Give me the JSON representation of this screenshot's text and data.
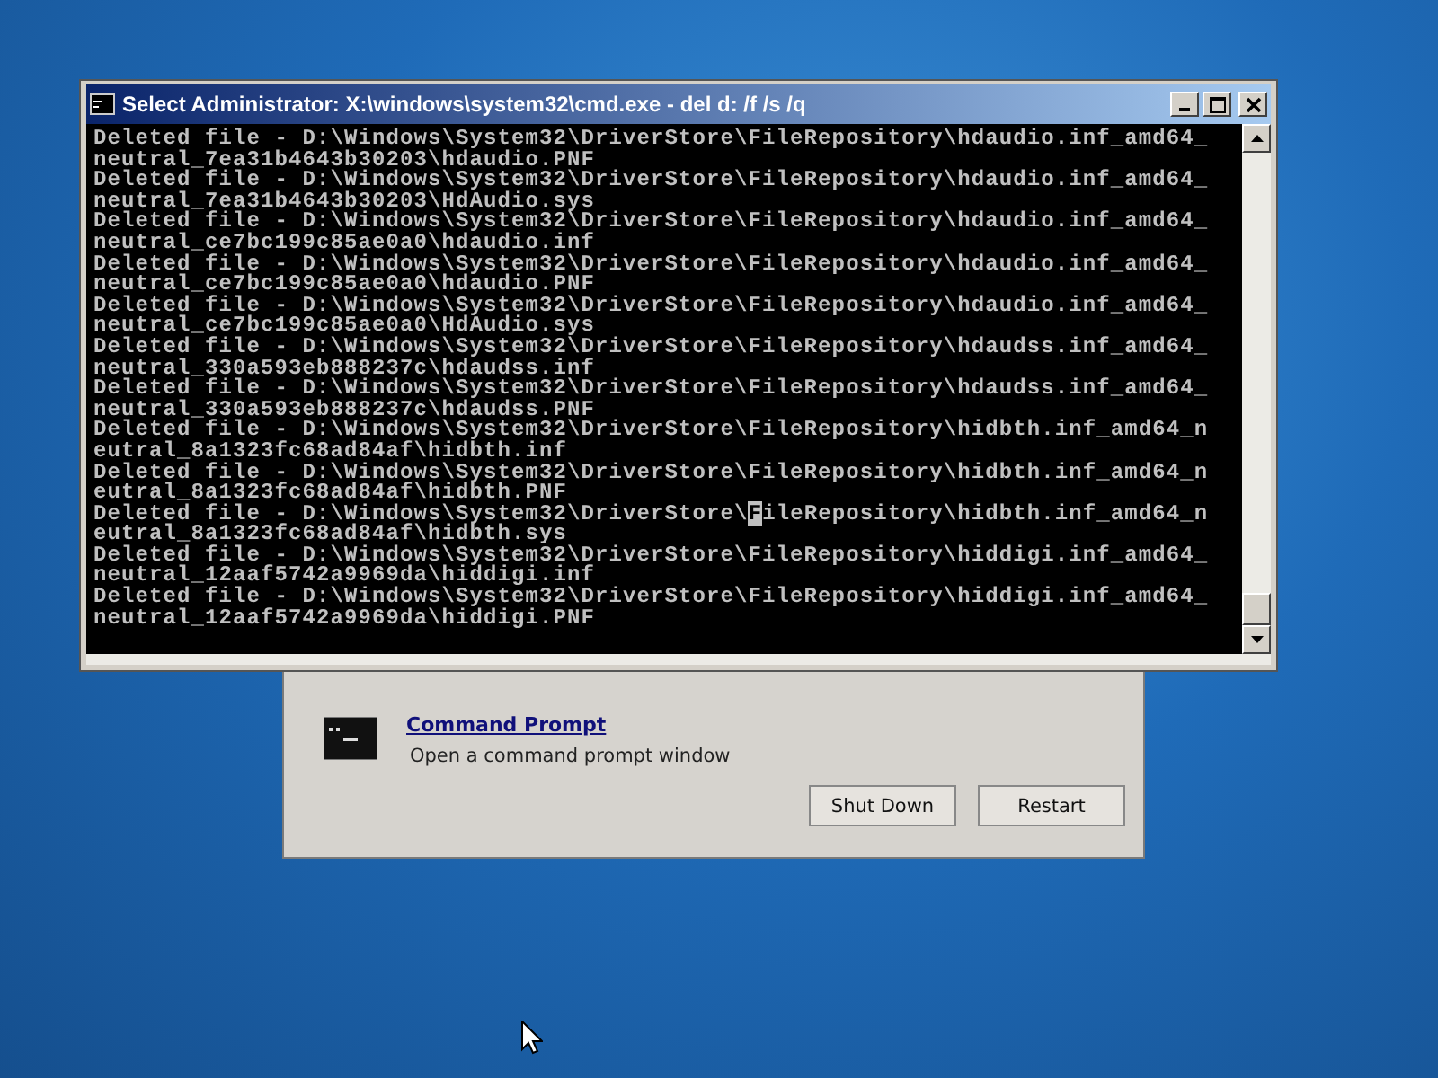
{
  "console_window": {
    "title": "Select Administrator: X:\\windows\\system32\\cmd.exe - del  d: /f /s /q",
    "lines": [
      {
        "text": "Deleted file - D:\\Windows\\System32\\DriverStore\\FileRepository\\hdaudio.inf_amd64_"
      },
      {
        "text": "neutral_7ea31b4643b30203\\hdaudio.PNF"
      },
      {
        "text": "Deleted file - D:\\Windows\\System32\\DriverStore\\FileRepository\\hdaudio.inf_amd64_"
      },
      {
        "text": "neutral_7ea31b4643b30203\\HdAudio.sys"
      },
      {
        "text": "Deleted file - D:\\Windows\\System32\\DriverStore\\FileRepository\\hdaudio.inf_amd64_"
      },
      {
        "text": "neutral_ce7bc199c85ae0a0\\hdaudio.inf"
      },
      {
        "text": "Deleted file - D:\\Windows\\System32\\DriverStore\\FileRepository\\hdaudio.inf_amd64_"
      },
      {
        "text": "neutral_ce7bc199c85ae0a0\\hdaudio.PNF"
      },
      {
        "text": "Deleted file - D:\\Windows\\System32\\DriverStore\\FileRepository\\hdaudio.inf_amd64_"
      },
      {
        "text": "neutral_ce7bc199c85ae0a0\\HdAudio.sys"
      },
      {
        "text": "Deleted file - D:\\Windows\\System32\\DriverStore\\FileRepository\\hdaudss.inf_amd64_"
      },
      {
        "text": "neutral_330a593eb888237c\\hdaudss.inf"
      },
      {
        "text": "Deleted file - D:\\Windows\\System32\\DriverStore\\FileRepository\\hdaudss.inf_amd64_"
      },
      {
        "text": "neutral_330a593eb888237c\\hdaudss.PNF"
      },
      {
        "text": "Deleted file - D:\\Windows\\System32\\DriverStore\\FileRepository\\hidbth.inf_amd64_n"
      },
      {
        "text": "eutral_8a1323fc68ad84af\\hidbth.inf"
      },
      {
        "text": "Deleted file - D:\\Windows\\System32\\DriverStore\\FileRepository\\hidbth.inf_amd64_n"
      },
      {
        "text": "eutral_8a1323fc68ad84af\\hidbth.PNF"
      },
      {
        "text": "Deleted file - D:\\Windows\\System32\\DriverStore\\",
        "cursor": "F",
        "after": "ileRepository\\hidbth.inf_amd64_n"
      },
      {
        "text": "eutral_8a1323fc68ad84af\\hidbth.sys"
      },
      {
        "text": "Deleted file - D:\\Windows\\System32\\DriverStore\\FileRepository\\hiddigi.inf_amd64_"
      },
      {
        "text": "neutral_12aaf5742a9969da\\hiddigi.inf"
      },
      {
        "text": "Deleted file - D:\\Windows\\System32\\DriverStore\\FileRepository\\hiddigi.inf_amd64_"
      },
      {
        "text": "neutral_12aaf5742a9969da\\hiddigi.PNF"
      }
    ]
  },
  "recovery_dialog": {
    "option": {
      "link": "Command Prompt",
      "description": "Open a command prompt window"
    },
    "buttons": [
      "Shut Down",
      "Restart"
    ]
  }
}
